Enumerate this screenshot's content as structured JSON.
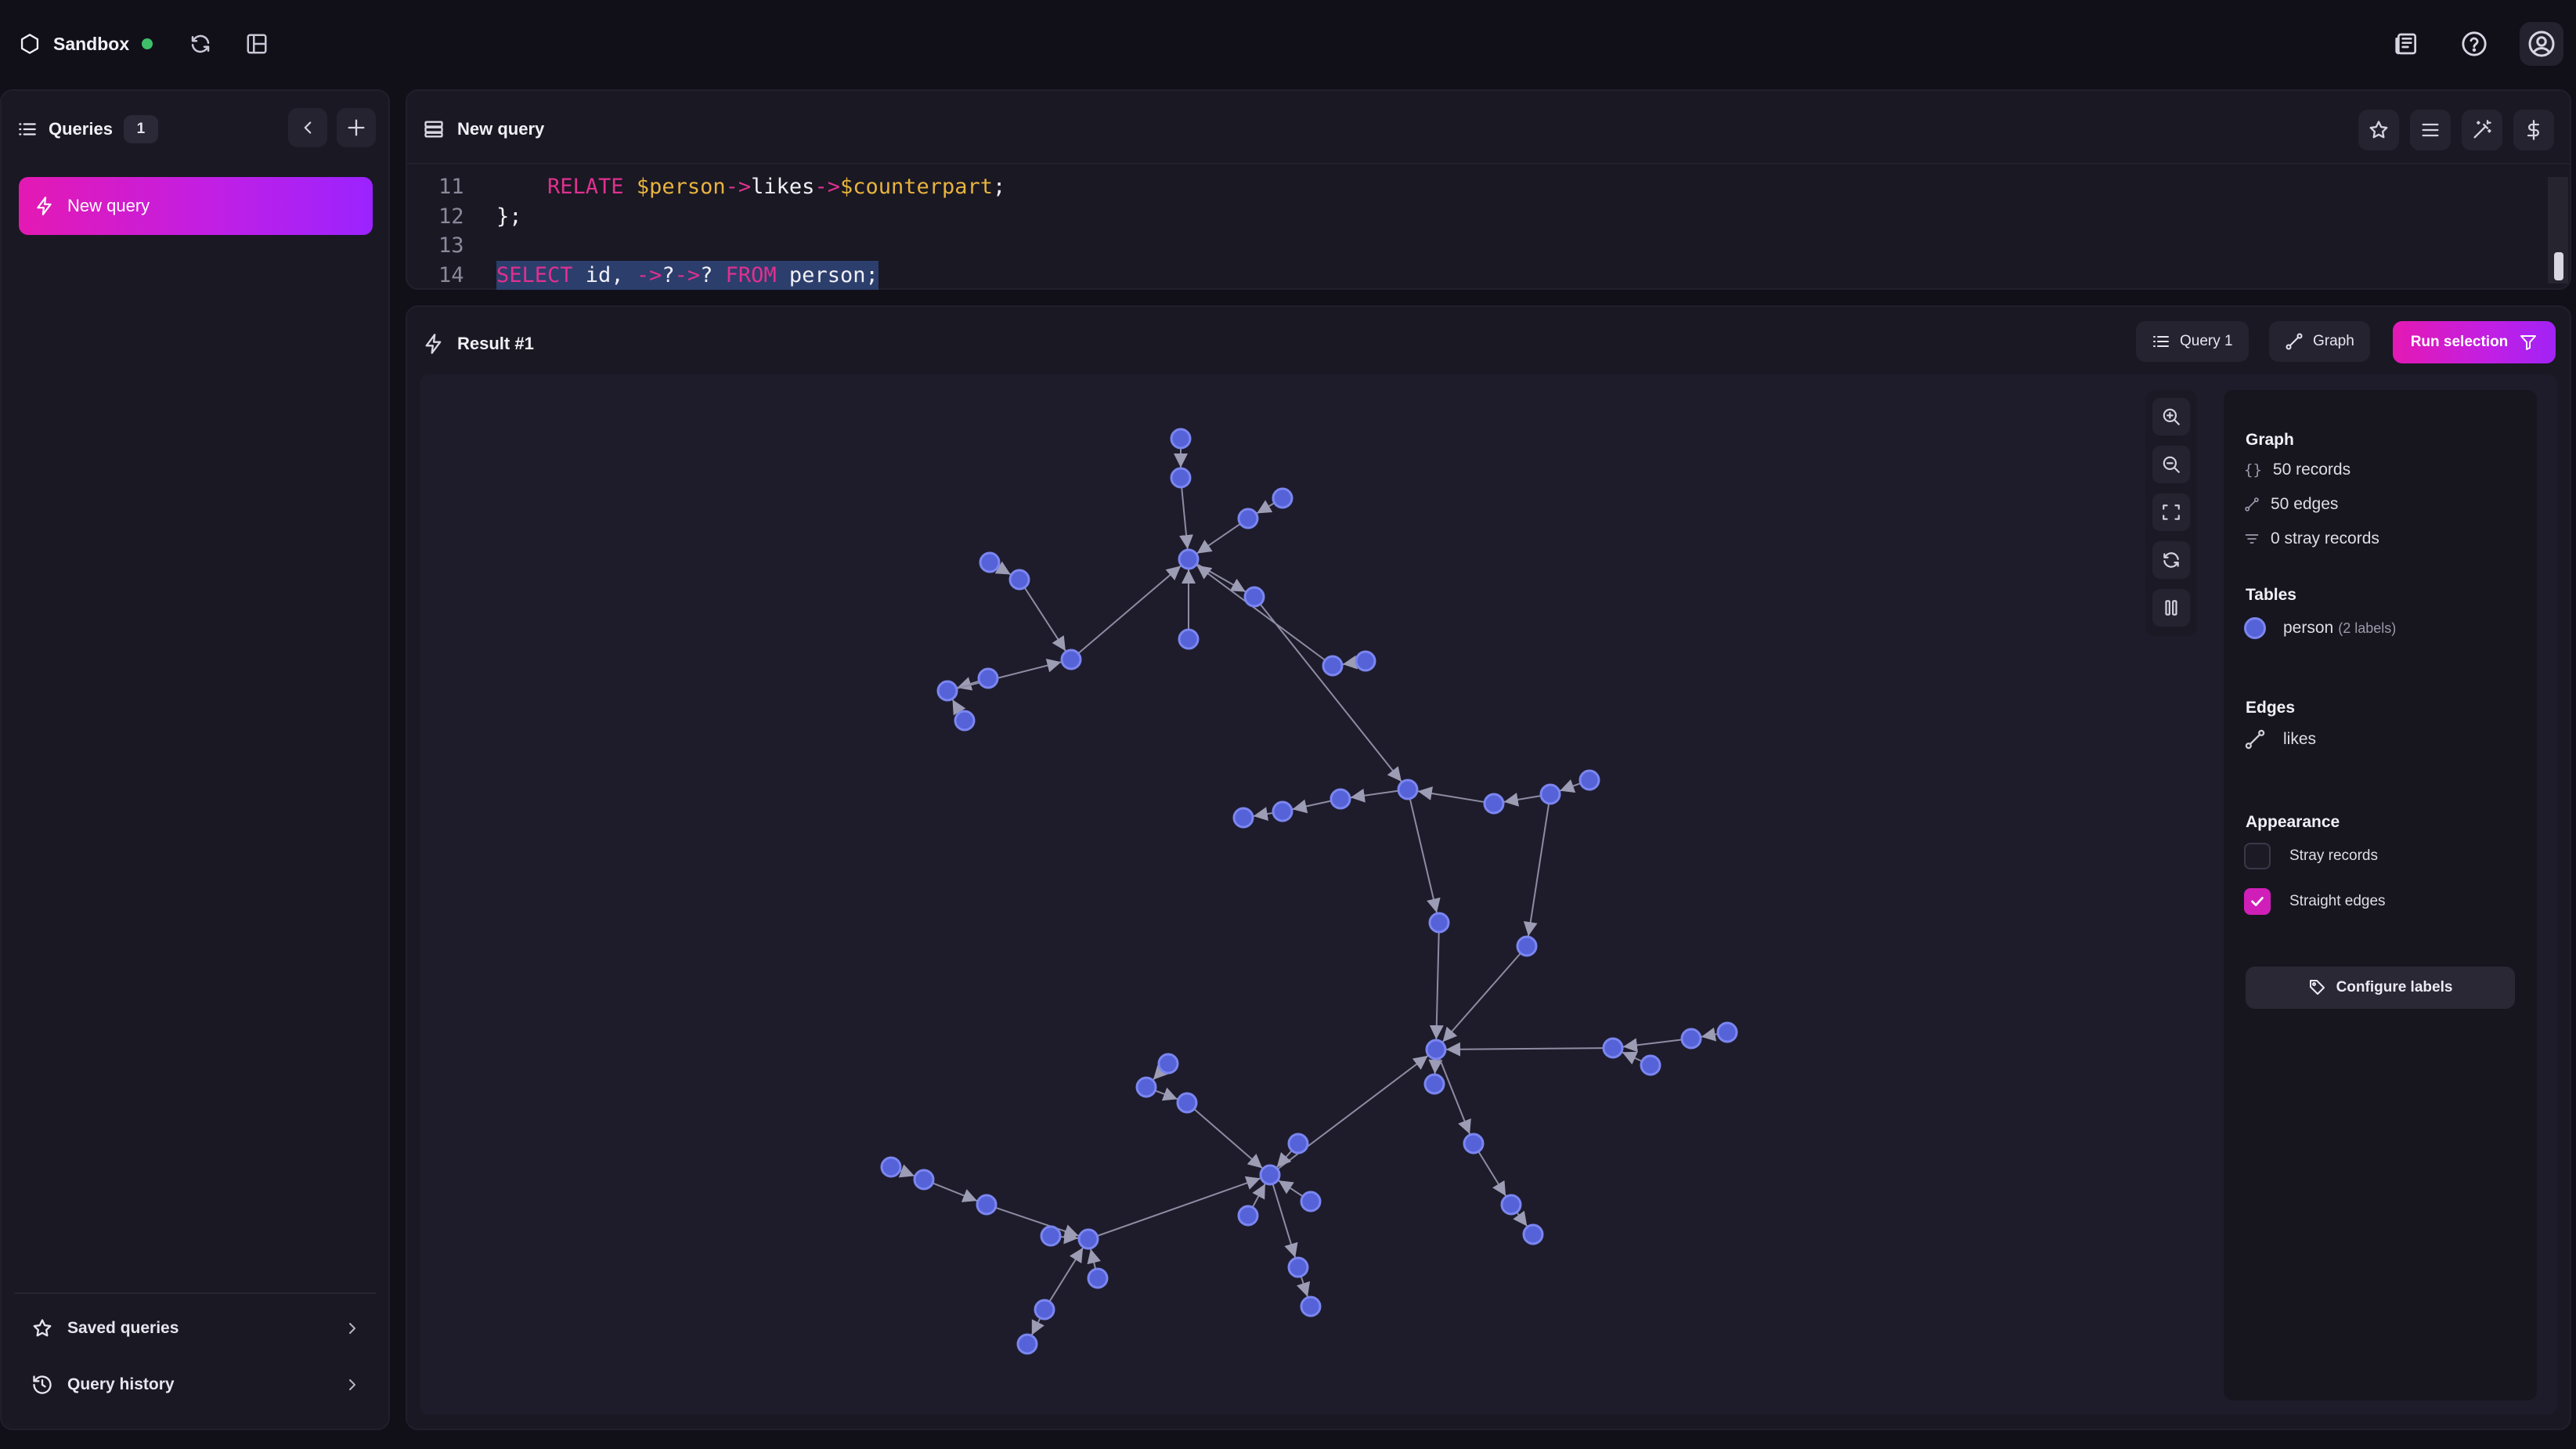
{
  "app": {
    "name": "Sandbox",
    "status_color": "#3ec06a"
  },
  "sidebar": {
    "title": "Queries",
    "count": "1",
    "queries": [
      {
        "label": "New query"
      }
    ],
    "links": [
      {
        "label": "Saved queries"
      },
      {
        "label": "Query history"
      }
    ]
  },
  "editor": {
    "title": "New query",
    "lines": [
      {
        "num": "11",
        "tokens": [
          {
            "t": "    ",
            "c": "plain"
          },
          {
            "t": "RELATE",
            "c": "kw"
          },
          {
            "t": " ",
            "c": "plain"
          },
          {
            "t": "$person",
            "c": "var"
          },
          {
            "t": "->",
            "c": "arrow"
          },
          {
            "t": "likes",
            "c": "plain"
          },
          {
            "t": "->",
            "c": "arrow"
          },
          {
            "t": "$counterpart",
            "c": "var"
          },
          {
            "t": ";",
            "c": "plain"
          }
        ]
      },
      {
        "num": "12",
        "tokens": [
          {
            "t": "};",
            "c": "plain"
          }
        ]
      },
      {
        "num": "13",
        "tokens": []
      },
      {
        "num": "14",
        "selected": true,
        "tokens": [
          {
            "t": "SELECT",
            "c": "kw"
          },
          {
            "t": " id, ",
            "c": "plain"
          },
          {
            "t": "->",
            "c": "arrow"
          },
          {
            "t": "?",
            "c": "plain"
          },
          {
            "t": "->",
            "c": "arrow"
          },
          {
            "t": "? ",
            "c": "plain"
          },
          {
            "t": "FROM",
            "c": "kw"
          },
          {
            "t": " person;",
            "c": "plain"
          }
        ]
      }
    ]
  },
  "result": {
    "title": "Result #1",
    "query_label": "Query 1",
    "view_label": "Graph",
    "run_label": "Run selection"
  },
  "graph_panel": {
    "title": "Graph",
    "records": "50 records",
    "edges": "50 edges",
    "stray": "0 stray records",
    "tables_title": "Tables",
    "table_name": "person",
    "table_meta": "(2 labels)",
    "table_color": "#5562d8",
    "edges_title": "Edges",
    "edge_name": "likes",
    "appearance_title": "Appearance",
    "stray_label": "Stray records",
    "stray_checked": false,
    "straight_label": "Straight edges",
    "straight_checked": true,
    "configure_label": "Configure labels"
  }
}
